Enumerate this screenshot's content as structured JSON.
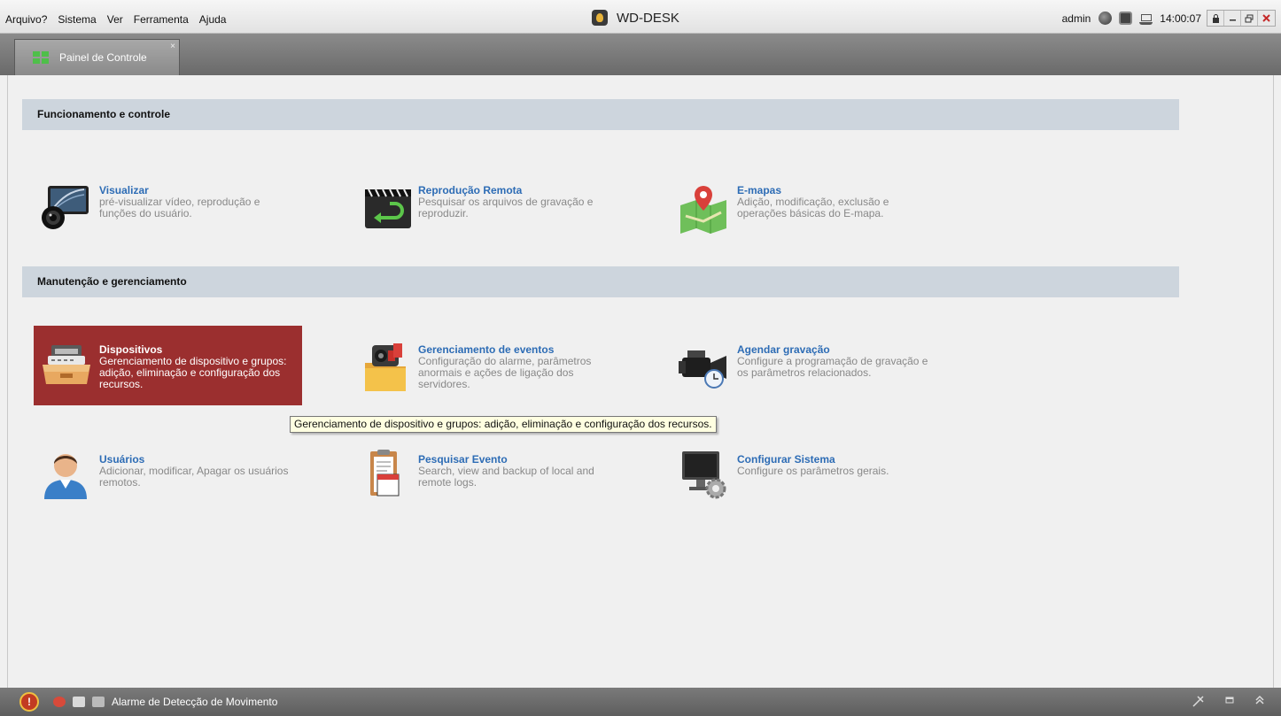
{
  "menubar": {
    "menus": [
      "Arquivo?",
      "Sistema",
      "Ver",
      "Ferramenta",
      "Ajuda"
    ],
    "app_title": "WD-DESK",
    "user": "admin",
    "clock": "14:00:07",
    "window_buttons": [
      "lock",
      "minimize",
      "restore",
      "close"
    ]
  },
  "tab": {
    "label": "Painel de Controle",
    "close": "×"
  },
  "sections": [
    {
      "title": "Funcionamento e controle",
      "cards": [
        {
          "title": "Visualizar",
          "desc": "pré-visualizar vídeo, reprodução e funções do usuário.",
          "icon": "monitor-camera-icon"
        },
        {
          "title": "Reprodução Remota",
          "desc": "Pesquisar os arquivos de gravação e reproduzir.",
          "icon": "clapperboard-playback-icon"
        },
        {
          "title": "E-mapas",
          "desc": "Adição, modificação, exclusão e operações básicas do E-mapa.",
          "icon": "map-pin-icon"
        }
      ]
    },
    {
      "title": "Manutenção e gerenciamento",
      "cards": [
        {
          "title": "Dispositivos",
          "desc": "Gerenciamento de dispositivo e grupos: adição, eliminação e configuração dos recursos.",
          "icon": "device-tray-icon"
        },
        {
          "title": "Gerenciamento de eventos",
          "desc": "Configuração do alarme, parâmetros anormais e ações de ligação dos servidores.",
          "icon": "event-folder-icon"
        },
        {
          "title": "Agendar gravação",
          "desc": "Configure a programação de gravação e os parâmetros relacionados.",
          "icon": "camera-clock-icon"
        },
        {
          "title": "Usuários",
          "desc": "Adicionar, modificar, Apagar os usuários remotos.",
          "icon": "user-icon"
        },
        {
          "title": "Pesquisar Evento",
          "desc": "Search, view and backup of local and remote logs.",
          "icon": "calendar-clipboard-icon"
        },
        {
          "title": "Configurar Sistema",
          "desc": "Configure os parâmetros gerais.",
          "icon": "monitor-gear-icon"
        }
      ]
    }
  ],
  "tooltip": "Gerenciamento de dispositivo e grupos: adição, eliminação e configuração dos recursos.",
  "statusbar": {
    "alarm_icon_glyph": "!",
    "text": "Alarme de Detecção de Movimento"
  },
  "colors": {
    "active_card": "#9b2f2f",
    "title_link": "#2d6cb5",
    "section_header": "#cdd5dd"
  }
}
